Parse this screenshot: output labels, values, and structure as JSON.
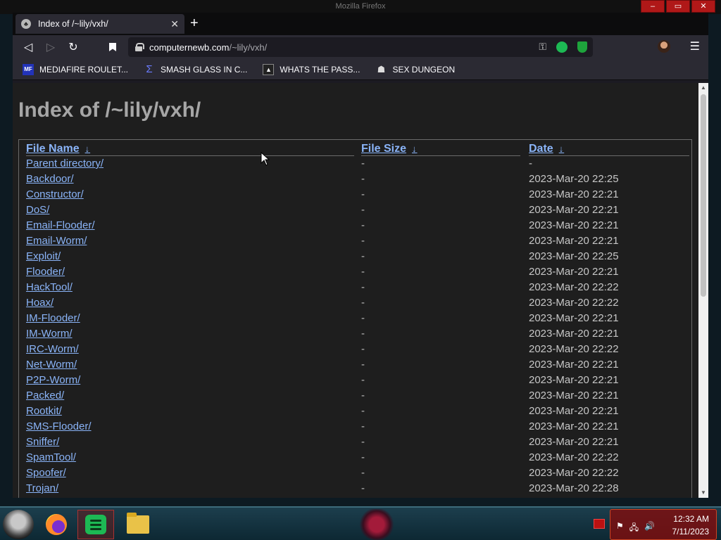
{
  "window": {
    "title": "Mozilla Firefox",
    "controls": [
      "–",
      "▭",
      "✕"
    ]
  },
  "tab": {
    "title": "Index of /~lily/vxh/",
    "close_glyph": "✕",
    "new_tab_glyph": "+"
  },
  "navbar": {
    "back_glyph": "◁",
    "forward_glyph": "▷",
    "reload_glyph": "↻",
    "url_domain": "computernewb.com",
    "url_path": "/~lily/vxh/",
    "menu_glyph": "☰"
  },
  "bookmarks": [
    {
      "label": "MEDIAFIRE ROULET...",
      "icon": "mediafire-icon",
      "icon_text": "MF"
    },
    {
      "label": "SMASH GLASS IN C...",
      "icon": "sigma-icon",
      "icon_text": "Σ"
    },
    {
      "label": "WHATS THE PASS...",
      "icon": "lock-icon",
      "icon_text": "▲"
    },
    {
      "label": "SEX DUNGEON",
      "icon": "dungeon-icon",
      "icon_text": "☗"
    }
  ],
  "page": {
    "title": "Index of /~lily/vxh/",
    "headers": {
      "name": "File Name",
      "size": "File Size",
      "date": "Date",
      "sort_arrow": "↓"
    },
    "rows": [
      {
        "name": "Parent directory/",
        "size": "-",
        "date": "-"
      },
      {
        "name": "Backdoor/",
        "size": "-",
        "date": "2023-Mar-20 22:25"
      },
      {
        "name": "Constructor/",
        "size": "-",
        "date": "2023-Mar-20 22:21"
      },
      {
        "name": "DoS/",
        "size": "-",
        "date": "2023-Mar-20 22:21"
      },
      {
        "name": "Email-Flooder/",
        "size": "-",
        "date": "2023-Mar-20 22:21"
      },
      {
        "name": "Email-Worm/",
        "size": "-",
        "date": "2023-Mar-20 22:21"
      },
      {
        "name": "Exploit/",
        "size": "-",
        "date": "2023-Mar-20 22:25"
      },
      {
        "name": "Flooder/",
        "size": "-",
        "date": "2023-Mar-20 22:21"
      },
      {
        "name": "HackTool/",
        "size": "-",
        "date": "2023-Mar-20 22:22"
      },
      {
        "name": "Hoax/",
        "size": "-",
        "date": "2023-Mar-20 22:22"
      },
      {
        "name": "IM-Flooder/",
        "size": "-",
        "date": "2023-Mar-20 22:21"
      },
      {
        "name": "IM-Worm/",
        "size": "-",
        "date": "2023-Mar-20 22:21"
      },
      {
        "name": "IRC-Worm/",
        "size": "-",
        "date": "2023-Mar-20 22:22"
      },
      {
        "name": "Net-Worm/",
        "size": "-",
        "date": "2023-Mar-20 22:21"
      },
      {
        "name": "P2P-Worm/",
        "size": "-",
        "date": "2023-Mar-20 22:21"
      },
      {
        "name": "Packed/",
        "size": "-",
        "date": "2023-Mar-20 22:21"
      },
      {
        "name": "Rootkit/",
        "size": "-",
        "date": "2023-Mar-20 22:21"
      },
      {
        "name": "SMS-Flooder/",
        "size": "-",
        "date": "2023-Mar-20 22:21"
      },
      {
        "name": "Sniffer/",
        "size": "-",
        "date": "2023-Mar-20 22:21"
      },
      {
        "name": "SpamTool/",
        "size": "-",
        "date": "2023-Mar-20 22:22"
      },
      {
        "name": "Spoofer/",
        "size": "-",
        "date": "2023-Mar-20 22:22"
      },
      {
        "name": "Trojan/",
        "size": "-",
        "date": "2023-Mar-20 22:28"
      }
    ]
  },
  "taskbar": {
    "time": "12:32 AM",
    "date": "7/11/2023",
    "tray_icons": [
      "⚑",
      "🖧",
      "🔊"
    ]
  },
  "colors": {
    "link": "#8ab4f8",
    "page_bg": "#1e1e1e",
    "toolbar_bg": "#2b2a33",
    "tray_red": "#820c0c"
  }
}
